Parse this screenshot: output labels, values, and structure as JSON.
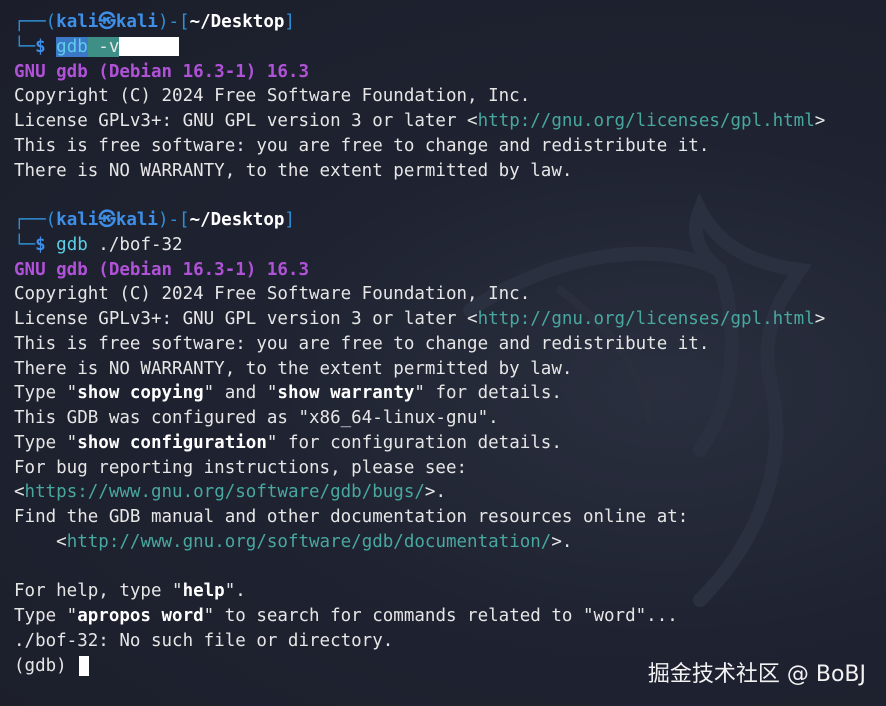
{
  "prompt1": {
    "corner": "┌──(",
    "user": "kali",
    "skull": "㉿",
    "host": "kali",
    "sep": ")-[",
    "path": "~/Desktop",
    "close": "]",
    "corner2": "└─",
    "dollar": "$ ",
    "command": "gdb",
    "args": " -v"
  },
  "output1": {
    "banner": "GNU gdb (Debian 16.3-1) 16.3",
    "copyright": "Copyright (C) 2024 Free Software Foundation, Inc.",
    "license_prefix": "License GPLv3+: GNU GPL version 3 or later <",
    "license_url": "http://gnu.org/licenses/gpl.html",
    "license_suffix": ">",
    "free": "This is free software: you are free to change and redistribute it.",
    "warranty": "There is NO WARRANTY, to the extent permitted by law."
  },
  "prompt2": {
    "corner": "┌──(",
    "user": "kali",
    "skull": "㉿",
    "host": "kali",
    "sep": ")-[",
    "path": "~/Desktop",
    "close": "]",
    "corner2": "└─",
    "dollar": "$ ",
    "command": "gdb",
    "args": " ./bof-32"
  },
  "output2": {
    "banner": "GNU gdb (Debian 16.3-1) 16.3",
    "copyright": "Copyright (C) 2024 Free Software Foundation, Inc.",
    "license_prefix": "License GPLv3+: GNU GPL version 3 or later <",
    "license_url": "http://gnu.org/licenses/gpl.html",
    "license_suffix": ">",
    "free": "This is free software: you are free to change and redistribute it.",
    "warranty": "There is NO WARRANTY, to the extent permitted by law.",
    "type1_a": "Type \"",
    "type1_b": "show copying",
    "type1_c": "\" and \"",
    "type1_d": "show warranty",
    "type1_e": "\" for details.",
    "configured": "This GDB was configured as \"x86_64-linux-gnu\".",
    "type2_a": "Type \"",
    "type2_b": "show configuration",
    "type2_c": "\" for configuration details.",
    "bug": "For bug reporting instructions, please see:",
    "bug_open": "<",
    "bug_url": "https://www.gnu.org/software/gdb/bugs/",
    "bug_close": ">.",
    "manual": "Find the GDB manual and other documentation resources online at:",
    "doc_indent": "    <",
    "doc_url": "http://www.gnu.org/software/gdb/documentation/",
    "doc_close": ">.",
    "help_a": "For help, type \"",
    "help_b": "help",
    "help_c": "\".",
    "apropos_a": "Type \"",
    "apropos_b": "apropos word",
    "apropos_c": "\" to search for commands related to \"word\"...",
    "error": "./bof-32: No such file or directory.",
    "gdb_prompt": "(gdb) "
  },
  "watermark": "掘金技术社区 @ BoBJ",
  "colors": {
    "background": "#1e2230",
    "prompt_blue": "#3e8fe8",
    "banner_purple": "#b052d8",
    "url_teal": "#48a8a0",
    "command_cyan": "#5ccfe6"
  }
}
